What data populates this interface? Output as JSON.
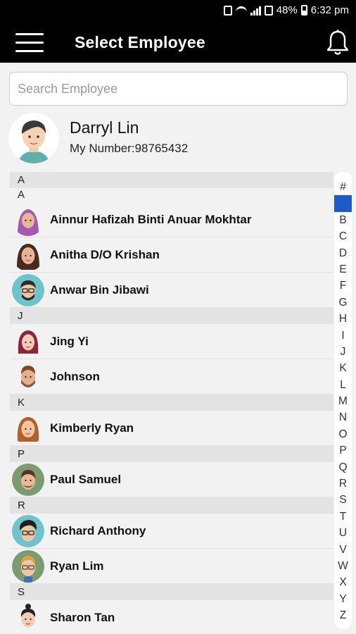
{
  "status_bar": {
    "battery": "48%",
    "time": "6:32 pm"
  },
  "app_bar": {
    "title": "Select Employee"
  },
  "search": {
    "placeholder": "Search Employee",
    "value": ""
  },
  "profile": {
    "name": "Darryl Lin",
    "number": "My Number:98765432"
  },
  "sections": [
    {
      "letter": "A",
      "sub": "A",
      "people": [
        "Ainnur Hafizah Binti Anuar Mokhtar",
        "Anitha D/O Krishan",
        "Anwar Bin Jibawi"
      ]
    },
    {
      "letter": "J",
      "people": [
        "Jing Yi",
        "Johnson"
      ]
    },
    {
      "letter": "K",
      "people": [
        "Kimberly Ryan"
      ]
    },
    {
      "letter": "P",
      "people": [
        "Paul Samuel"
      ]
    },
    {
      "letter": "R",
      "people": [
        "Richard Anthony",
        "Ryan Lim"
      ]
    },
    {
      "letter": "S",
      "people": [
        "Sharon Tan"
      ]
    }
  ],
  "index": [
    "#",
    "A",
    "B",
    "C",
    "D",
    "E",
    "F",
    "G",
    "H",
    "I",
    "J",
    "K",
    "L",
    "M",
    "N",
    "O",
    "P",
    "Q",
    "R",
    "S",
    "T",
    "U",
    "V",
    "W",
    "X",
    "Y",
    "Z"
  ],
  "index_active": "A",
  "colors": {
    "bar": "#000000",
    "active_index": "#1e5bc6"
  }
}
